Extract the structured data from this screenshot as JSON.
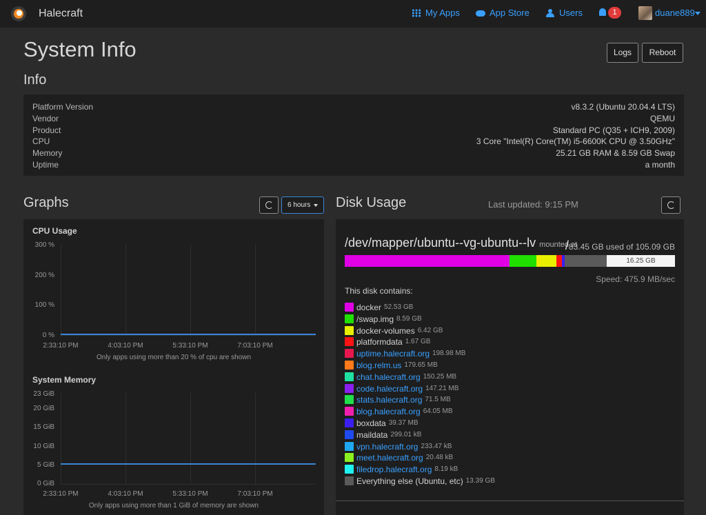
{
  "nav": {
    "brand": "Halecraft",
    "links": [
      {
        "label": "My Apps",
        "icon": "grid-icon"
      },
      {
        "label": "App Store",
        "icon": "cloud-download-icon"
      },
      {
        "label": "Users",
        "icon": "users-icon"
      }
    ],
    "notifications": "1",
    "username": "duane889"
  },
  "page": {
    "title": "System Info",
    "logs_label": "Logs",
    "reboot_label": "Reboot"
  },
  "info": {
    "title": "Info",
    "rows": [
      {
        "key": "Platform Version",
        "value": "v8.3.2 (Ubuntu 20.04.4 LTS)"
      },
      {
        "key": "Vendor",
        "value": "QEMU"
      },
      {
        "key": "Product",
        "value": "Standard PC (Q35 + ICH9, 2009)"
      },
      {
        "key": "CPU",
        "value": "3 Core \"Intel(R) Core(TM) i5-6600K CPU @ 3.50GHz\""
      },
      {
        "key": "Memory",
        "value": "25.21 GB RAM & 8.59 GB Swap"
      },
      {
        "key": "Uptime",
        "value": "a month"
      }
    ]
  },
  "graphs": {
    "title": "Graphs",
    "period": "6 hours",
    "cpu": {
      "title": "CPU Usage",
      "y_ticks": [
        "300 %",
        "200 %",
        "100 %",
        "0 %"
      ],
      "x_ticks": [
        "2:33:10 PM",
        "4:03:10 PM",
        "5:33:10 PM",
        "7:03:10 PM"
      ],
      "note": "Only apps using more than 20 % of cpu are shown",
      "level": 0.02
    },
    "memory": {
      "title": "System Memory",
      "y_ticks": [
        "23 GiB",
        "20 GiB",
        "15 GiB",
        "10 GiB",
        "5 GiB",
        "0 GiB"
      ],
      "x_ticks": [
        "2:33:10 PM",
        "4:03:10 PM",
        "5:33:10 PM",
        "7:03:10 PM"
      ],
      "note": "Only apps using more than 1 GiB of memory are shown",
      "level_gib": 5.3
    }
  },
  "disk": {
    "title": "Disk Usage",
    "last_updated": "Last updated: 9:15 PM",
    "device": "/dev/mapper/ubuntu--vg-ubuntu--lv",
    "mounted_at_label": "mounted at",
    "mount_point": "/",
    "used_text": "83.45 GB used of 105.09 GB",
    "free_label": "16.25 GB",
    "speed": "Speed: 475.9 MB/sec",
    "contains_label": "This disk contains:",
    "items": [
      {
        "name": "docker",
        "size": "52.53 GB",
        "color": "#e000e6",
        "link": false
      },
      {
        "name": "/swap.img",
        "size": "8.59 GB",
        "color": "#1fe000",
        "link": false
      },
      {
        "name": "docker-volumes",
        "size": "6.42 GB",
        "color": "#e8f000",
        "link": false
      },
      {
        "name": "platformdata",
        "size": "1.67 GB",
        "color": "#ff1414",
        "link": false
      },
      {
        "name": "uptime.halecraft.org",
        "size": "198.98 MB",
        "color": "#e8174e",
        "link": true
      },
      {
        "name": "blog.relm.us",
        "size": "179.65 MB",
        "color": "#ff7a1a",
        "link": true
      },
      {
        "name": "chat.halecraft.org",
        "size": "150.25 MB",
        "color": "#1fe0a0",
        "link": true
      },
      {
        "name": "code.halecraft.org",
        "size": "147.21 MB",
        "color": "#8a1ff0",
        "link": true
      },
      {
        "name": "stats.halecraft.org",
        "size": "71.5 MB",
        "color": "#1fe04a",
        "link": true
      },
      {
        "name": "blog.halecraft.org",
        "size": "64.05 MB",
        "color": "#f01fb0",
        "link": true
      },
      {
        "name": "boxdata",
        "size": "39.37 MB",
        "color": "#3b1ff0",
        "link": false
      },
      {
        "name": "maildata",
        "size": "299.01 kB",
        "color": "#1f4af0",
        "link": false
      },
      {
        "name": "vpn.halecraft.org",
        "size": "233.47 kB",
        "color": "#1fa8f0",
        "link": true
      },
      {
        "name": "meet.halecraft.org",
        "size": "20.48 kB",
        "color": "#8af01f",
        "link": true
      },
      {
        "name": "filedrop.halecraft.org",
        "size": "8.19 kB",
        "color": "#1ff0f0",
        "link": true
      },
      {
        "name": "Everything else (Ubuntu, etc)",
        "size": "13.39 GB",
        "color": "#5a5a5a",
        "link": false
      }
    ],
    "bar_segments": [
      {
        "gb": 52.53,
        "color": "#e000e6"
      },
      {
        "gb": 8.59,
        "color": "#1fe000"
      },
      {
        "gb": 6.42,
        "color": "#e8f000"
      },
      {
        "gb": 1.67,
        "color": "#ff1414"
      },
      {
        "gb": 0.84,
        "color": "#3b1ff0"
      },
      {
        "gb": 13.39,
        "color": "#5a5a5a"
      }
    ],
    "total_gb": 105.09
  }
}
